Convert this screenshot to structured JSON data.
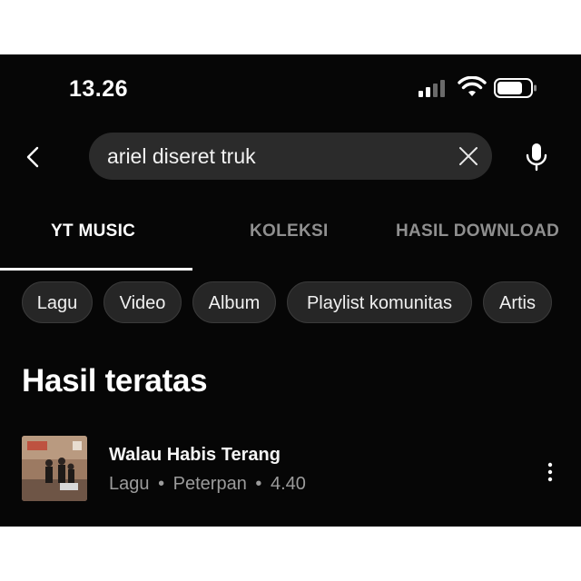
{
  "status_bar": {
    "time": "13.26"
  },
  "search": {
    "query": "ariel diseret truk"
  },
  "tabs": [
    {
      "label": "YT MUSIC",
      "active": true
    },
    {
      "label": "KOLEKSI",
      "active": false
    },
    {
      "label": "HASIL DOWNLOAD",
      "active": false
    }
  ],
  "chips": [
    "Lagu",
    "Video",
    "Album",
    "Playlist komunitas",
    "Artis"
  ],
  "section": {
    "title": "Hasil teratas"
  },
  "result": {
    "title": "Walau Habis Terang",
    "type": "Lagu",
    "artist": "Peterpan",
    "duration": "4.40",
    "separator": "•"
  },
  "colors": {
    "background": "#060606",
    "chip_bg": "#262626",
    "search_bg": "#2b2b2b",
    "muted": "#9b9b9b"
  },
  "icons": [
    "signal-icon",
    "wifi-icon",
    "battery-icon",
    "back-icon",
    "close-icon",
    "mic-icon",
    "more-vert-icon"
  ]
}
